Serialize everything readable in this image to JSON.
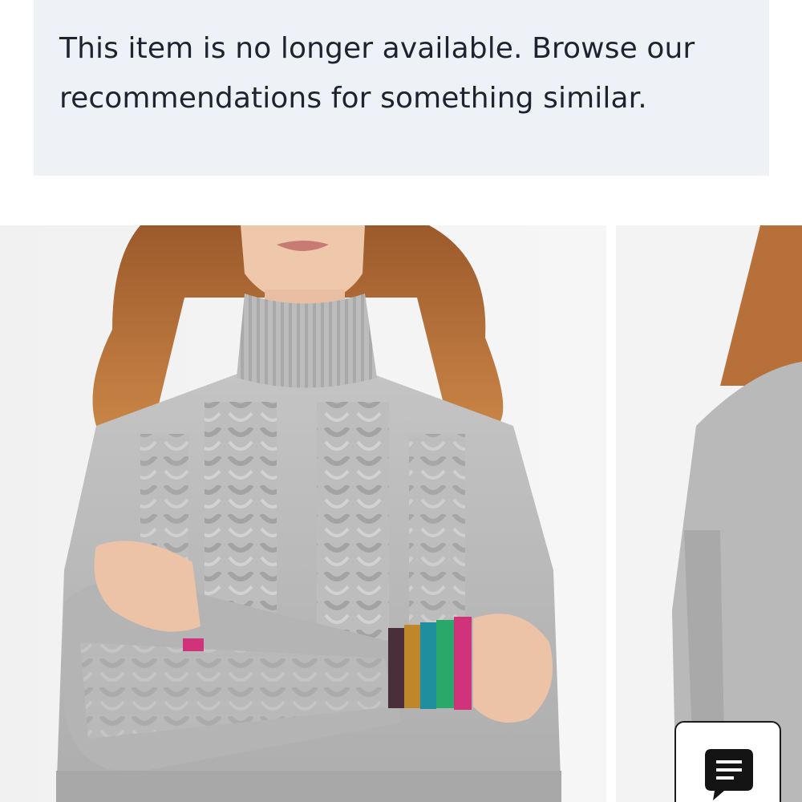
{
  "notice": {
    "message_line1": "This item is no longer available. Browse our",
    "message_line2": "recommendations for something similar."
  },
  "carousel": {
    "images": [
      {
        "name": "product-image-front",
        "subject": "grey cable knit turtleneck sweater with rainbow striped cuffs, front view"
      },
      {
        "name": "product-image-side",
        "subject": "grey knit sweater, side view"
      }
    ]
  },
  "chat": {
    "icon": "chat-bubble-icon"
  },
  "colors": {
    "notice_background": "#eef1f5",
    "text": "#1d2430",
    "sweater": "#b9b9b9",
    "hair": "#b8703a",
    "cuff_stripes": [
      "#4a2f3a",
      "#c0862a",
      "#1f8fa0",
      "#28a96a",
      "#d0337a"
    ]
  }
}
